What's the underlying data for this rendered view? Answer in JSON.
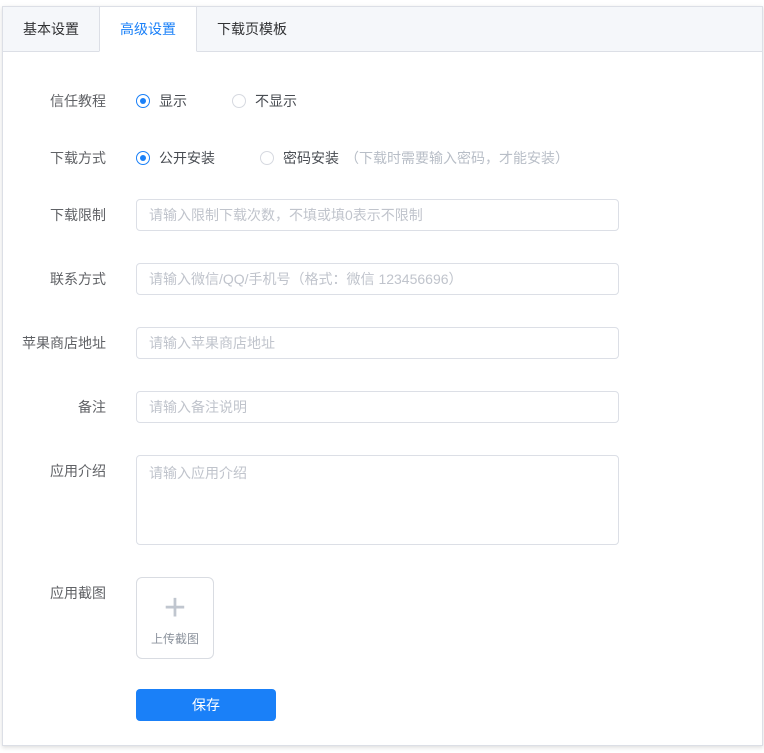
{
  "colors": {
    "accent": "#1a80f8",
    "tab_bg": "#f5f7fa",
    "border": "#dcdfe6",
    "placeholder": "#c0c4cc",
    "note": "#b8bec7"
  },
  "tabs": [
    {
      "label": "基本设置",
      "active": false
    },
    {
      "label": "高级设置",
      "active": true
    },
    {
      "label": "下载页模板",
      "active": false
    }
  ],
  "form": {
    "trust_tutorial": {
      "label": "信任教程",
      "option_show": "显示",
      "option_hide": "不显示"
    },
    "download_method": {
      "label": "下载方式",
      "option_public": "公开安装",
      "option_password": "密码安装",
      "note": "（下载时需要输入密码，才能安装）"
    },
    "download_limit": {
      "label": "下载限制",
      "placeholder": "请输入限制下载次数，不填或填0表示不限制"
    },
    "contact": {
      "label": "联系方式",
      "placeholder": "请输入微信/QQ/手机号（格式：微信 123456696）"
    },
    "appstore_url": {
      "label": "苹果商店地址",
      "placeholder": "请输入苹果商店地址"
    },
    "remark": {
      "label": "备注",
      "placeholder": "请输入备注说明"
    },
    "app_intro": {
      "label": "应用介绍",
      "placeholder": "请输入应用介绍"
    },
    "app_screenshot": {
      "label": "应用截图",
      "plus": "+",
      "upload_text": "上传截图"
    },
    "save_label": "保存"
  }
}
